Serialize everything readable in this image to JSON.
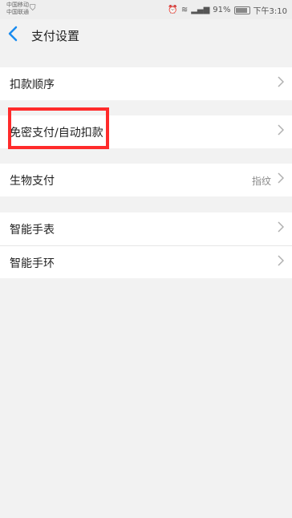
{
  "status": {
    "carrier1": "中国移动",
    "carrier2": "中国联通",
    "battery": "91%",
    "time": "下午3:10"
  },
  "header": {
    "title": "支付设置"
  },
  "groups": [
    {
      "items": [
        {
          "label": "扣款顺序"
        }
      ]
    },
    {
      "items": [
        {
          "label": "免密支付/自动扣款"
        }
      ]
    },
    {
      "items": [
        {
          "label": "生物支付",
          "value": "指纹"
        }
      ]
    },
    {
      "items": [
        {
          "label": "智能手表"
        },
        {
          "label": "智能手环"
        }
      ]
    }
  ],
  "colors": {
    "accent": "#1a8cf0",
    "highlight": "#ff2b2b"
  }
}
